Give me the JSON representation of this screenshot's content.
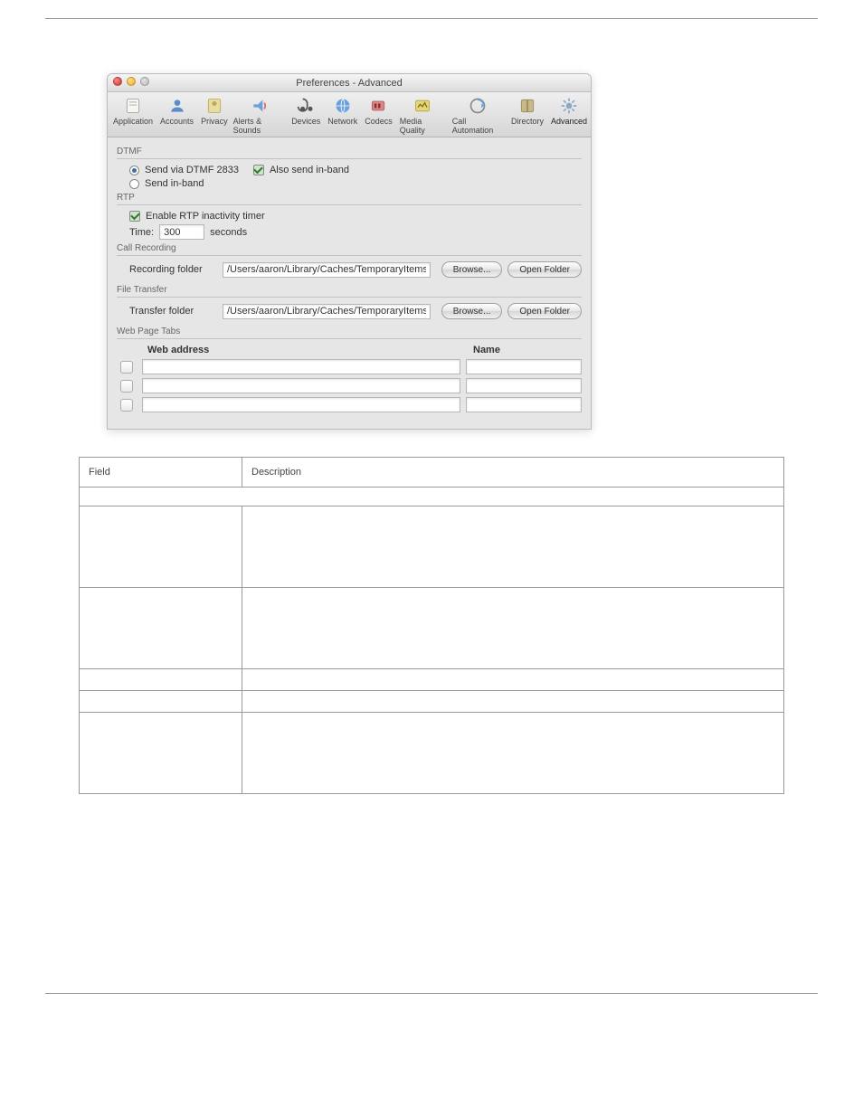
{
  "window": {
    "title": "Preferences - Advanced"
  },
  "toolbar": {
    "items": [
      {
        "label": "Application",
        "icon": "app"
      },
      {
        "label": "Accounts",
        "icon": "accounts"
      },
      {
        "label": "Privacy",
        "icon": "privacy"
      },
      {
        "label": "Alerts & Sounds",
        "icon": "alerts"
      },
      {
        "label": "Devices",
        "icon": "devices"
      },
      {
        "label": "Network",
        "icon": "network"
      },
      {
        "label": "Codecs",
        "icon": "codecs"
      },
      {
        "label": "Media Quality",
        "icon": "media"
      },
      {
        "label": "Call Automation",
        "icon": "callauto"
      },
      {
        "label": "Directory",
        "icon": "directory"
      },
      {
        "label": "Advanced",
        "icon": "advanced"
      }
    ]
  },
  "groups": {
    "dtmf": {
      "title": "DTMF",
      "opt_rfc": "Send via DTMF 2833",
      "also_inband": "Also send in-band",
      "opt_inband": "Send in-band"
    },
    "rtp": {
      "title": "RTP",
      "enable": "Enable RTP inactivity timer",
      "time_label": "Time:",
      "time_value": "300",
      "seconds": "seconds"
    },
    "rec": {
      "title": "Call Recording",
      "label": "Recording folder",
      "path": "/Users/aaron/Library/Caches/TemporaryItems/",
      "browse": "Browse...",
      "open": "Open Folder"
    },
    "ft": {
      "title": "File Transfer",
      "label": "Transfer folder",
      "path": "/Users/aaron/Library/Caches/TemporaryItems/",
      "browse": "Browse...",
      "open": "Open Folder"
    },
    "wpt": {
      "title": "Web Page Tabs",
      "col_addr": "Web address",
      "col_name": "Name"
    }
  },
  "desc_table": {
    "head_field": "Field",
    "head_desc": "Description"
  }
}
